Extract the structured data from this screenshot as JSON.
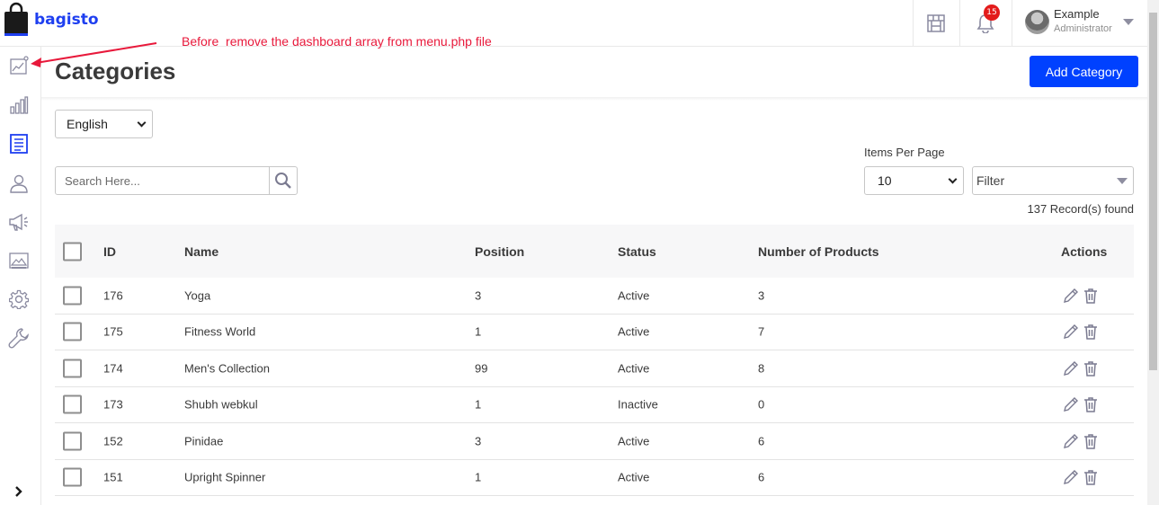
{
  "brand": {
    "name": "bagisto"
  },
  "header": {
    "notifications_count": "15",
    "user": {
      "name": "Example",
      "role": "Administrator"
    }
  },
  "annotation": "Before  remove the dashboard array from menu.php file",
  "sidebar": {
    "items": [
      {
        "icon": "dashboard-chart-icon"
      },
      {
        "icon": "bar-chart-icon"
      },
      {
        "icon": "catalog-list-icon",
        "active": true
      },
      {
        "icon": "customer-icon"
      },
      {
        "icon": "megaphone-icon"
      },
      {
        "icon": "cms-icon"
      },
      {
        "icon": "settings-gear-icon"
      },
      {
        "icon": "wrench-icon"
      }
    ],
    "toggle_icon": "chevron-right-icon"
  },
  "page": {
    "title": "Categories",
    "add_label": "Add Category",
    "locale": "English",
    "search_placeholder": "Search Here...",
    "items_per_page_label": "Items Per Page",
    "items_per_page": "10",
    "filter_label": "Filter",
    "records": "137 Record(s) found"
  },
  "table": {
    "columns": {
      "id": "ID",
      "name": "Name",
      "position": "Position",
      "status": "Status",
      "products": "Number of Products",
      "actions": "Actions"
    },
    "rows": [
      {
        "id": "176",
        "name": "Yoga",
        "position": "3",
        "status": "Active",
        "products": "3"
      },
      {
        "id": "175",
        "name": "Fitness World",
        "position": "1",
        "status": "Active",
        "products": "7"
      },
      {
        "id": "174",
        "name": "Men's Collection",
        "position": "99",
        "status": "Active",
        "products": "8"
      },
      {
        "id": "173",
        "name": "Shubh webkul",
        "position": "1",
        "status": "Inactive",
        "products": "0"
      },
      {
        "id": "152",
        "name": "Pinidae",
        "position": "3",
        "status": "Active",
        "products": "6"
      },
      {
        "id": "151",
        "name": "Upright Spinner",
        "position": "1",
        "status": "Active",
        "products": "6"
      }
    ]
  },
  "colors": {
    "brand": "#1e3ff0",
    "primary_button": "#0041ff",
    "annotation": "#e8193b",
    "badge": "#e31b1b"
  }
}
